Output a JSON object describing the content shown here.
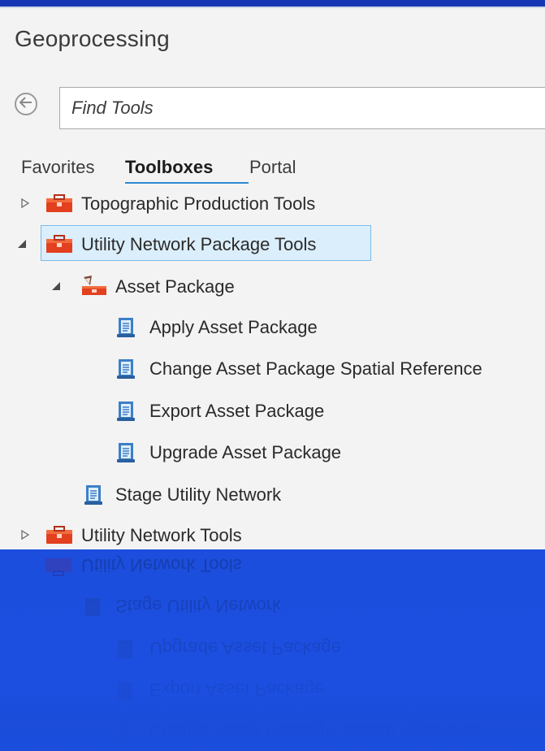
{
  "panel": {
    "title": "Geoprocessing",
    "search": {
      "placeholder": "Find Tools",
      "value": ""
    },
    "tabs": [
      {
        "label": "Favorites",
        "active": false
      },
      {
        "label": "Toolboxes",
        "active": true
      },
      {
        "label": "Portal",
        "active": false
      }
    ],
    "accent_color": "#2a8ad4",
    "selection_color": "#dbeefb"
  },
  "tree": [
    {
      "label": "Topographic Production Tools",
      "kind": "toolbox",
      "expanded": false,
      "icon": "toolbox-icon"
    },
    {
      "label": "Utility Network Package Tools",
      "kind": "toolbox",
      "expanded": true,
      "selected": true,
      "icon": "toolbox-icon",
      "children": [
        {
          "label": "Asset Package",
          "kind": "toolset",
          "expanded": true,
          "icon": "toolset-icon",
          "children": [
            {
              "label": "Apply Asset Package",
              "kind": "tool",
              "icon": "script-tool-icon"
            },
            {
              "label": "Change Asset Package Spatial Reference",
              "kind": "tool",
              "icon": "script-tool-icon"
            },
            {
              "label": "Export Asset Package",
              "kind": "tool",
              "icon": "script-tool-icon"
            },
            {
              "label": "Upgrade Asset Package",
              "kind": "tool",
              "icon": "script-tool-icon"
            }
          ]
        },
        {
          "label": "Stage Utility Network",
          "kind": "tool",
          "icon": "script-tool-icon"
        }
      ]
    },
    {
      "label": "Utility Network Tools",
      "kind": "toolbox",
      "expanded": false,
      "icon": "toolbox-icon"
    }
  ]
}
